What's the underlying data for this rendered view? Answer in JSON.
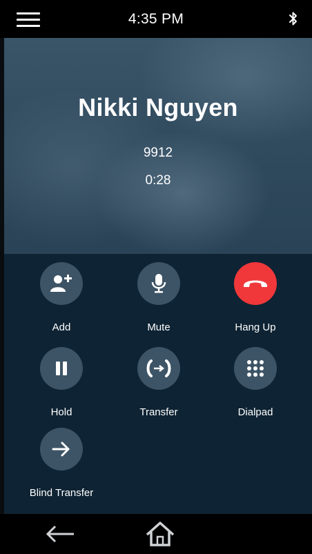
{
  "status_bar": {
    "time": "4:35 PM",
    "menu_icon": "hamburger-menu-icon",
    "bluetooth_icon": "bluetooth-icon"
  },
  "call": {
    "name": "Nikki Nguyen",
    "number": "9912",
    "duration": "0:28"
  },
  "actions": [
    {
      "label": "Add",
      "icon": "add-person-icon"
    },
    {
      "label": "Mute",
      "icon": "microphone-icon"
    },
    {
      "label": "Hang Up",
      "icon": "hang-up-phone-icon",
      "color": "#f0383b"
    },
    {
      "label": "Hold",
      "icon": "pause-icon"
    },
    {
      "label": "Transfer",
      "icon": "transfer-icon"
    },
    {
      "label": "Dialpad",
      "icon": "dialpad-icon"
    },
    {
      "label": "Blind Transfer",
      "icon": "arrow-right-icon"
    }
  ],
  "nav": {
    "back_icon": "back-arrow-icon",
    "home_icon": "home-icon"
  },
  "colors": {
    "button_bg": "#3d5466",
    "hang_up": "#f0383b",
    "panel_bg": "#0e2333",
    "header_bg": "#304a5e"
  }
}
